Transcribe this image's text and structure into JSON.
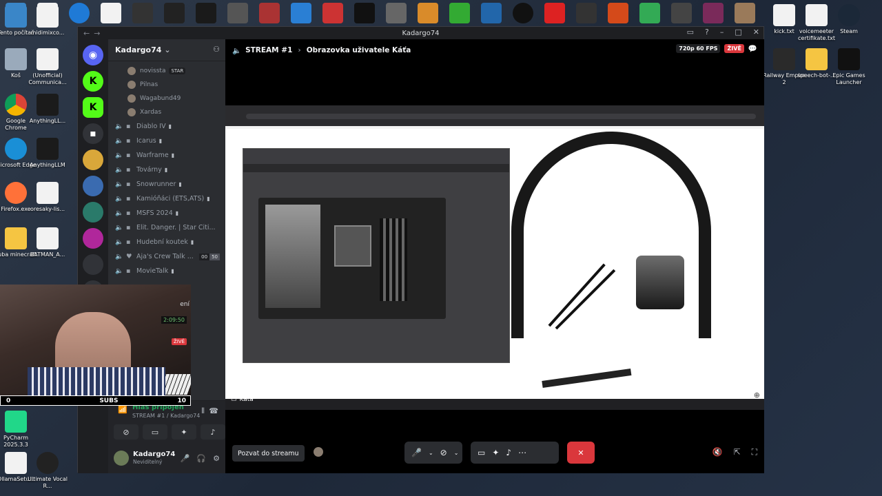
{
  "desktop": {
    "icons_left": [
      {
        "label": "Tento počítač"
      },
      {
        "label": "Koš"
      },
      {
        "label": "Google Chrome"
      },
      {
        "label": "Microsoft Edge"
      },
      {
        "label": "Firefox.exe"
      },
      {
        "label": "kuba minecraft"
      },
      {
        "label": "PyCharm 2025.3.3"
      },
      {
        "label": "OllamaSetu..."
      }
    ],
    "icons_col2": [
      {
        "label": "midimixco..."
      },
      {
        "label": "(Unofficial) Communica..."
      },
      {
        "label": "AnythingLL..."
      },
      {
        "label": "AnythingLLM"
      },
      {
        "label": "oresaky-lis..."
      },
      {
        "label": "BATMAN_A..."
      },
      {
        "label": "Ultimate Vocal R..."
      }
    ],
    "icons_right": [
      {
        "label": "kick.txt"
      },
      {
        "label": "voicemeeter certifikate.txt"
      },
      {
        "label": "Steam"
      },
      {
        "label": "Railway Empire 2"
      },
      {
        "label": "speech-bot-..."
      },
      {
        "label": "Epic Games Launcher"
      }
    ]
  },
  "window": {
    "title": "Kadargo74"
  },
  "server": {
    "name": "Kadargo74",
    "members": [
      {
        "name": "novissta",
        "tag": "STAR"
      },
      {
        "name": "Pilnas",
        "tag": ""
      },
      {
        "name": "Wagabund49",
        "tag": ""
      },
      {
        "name": "Xardas",
        "tag": ""
      }
    ],
    "voice_channels": [
      {
        "name": "Diablo IV"
      },
      {
        "name": "Icarus"
      },
      {
        "name": "Warframe"
      },
      {
        "name": "Továrny"
      },
      {
        "name": "Snowrunner"
      },
      {
        "name": "Kamióňáci (ETS,ATS)"
      },
      {
        "name": "MSFS 2024"
      },
      {
        "name": "Elit. Danger. | Star Citi..."
      },
      {
        "name": "Hudební koutek"
      },
      {
        "name": "Aja's Crew Talk ...",
        "count_a": "00",
        "count_b": "50"
      },
      {
        "name": "MovieTalk"
      }
    ]
  },
  "voice_panel": {
    "status": "Hlas připojen",
    "channel": "STREAM #1 / Kadargo74"
  },
  "user": {
    "name": "Kadargo74",
    "status": "Neviditelný"
  },
  "stage": {
    "channel": "STREAM #1",
    "title": "Obrazovka uživatele Káťa",
    "quality": "720p 60 FPS",
    "live": "ŽIVĚ",
    "streamer": "Káťa",
    "invite_label": "Pozvat do streamu"
  },
  "overlay": {
    "timer": "2:09:50",
    "live": "ŽIVĚ",
    "subs_left": "0",
    "subs_label": "SUBS",
    "subs_right": "10",
    "side_text": "ení"
  }
}
